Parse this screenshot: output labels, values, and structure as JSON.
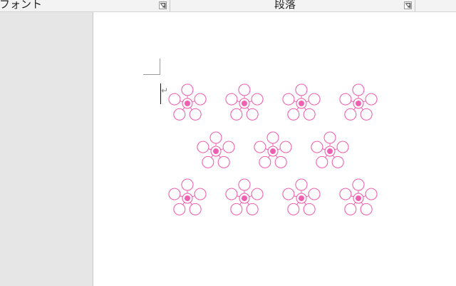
{
  "ribbon": {
    "group_font": "フォント",
    "group_paragraph": "段落"
  },
  "document": {
    "paragraph_mark": "↵",
    "flower_colors": {
      "outline": "#f060b0",
      "center_fill": "#f060b0"
    },
    "flower_rows": [
      {
        "count": 4
      },
      {
        "count": 3
      },
      {
        "count": 4
      }
    ]
  }
}
